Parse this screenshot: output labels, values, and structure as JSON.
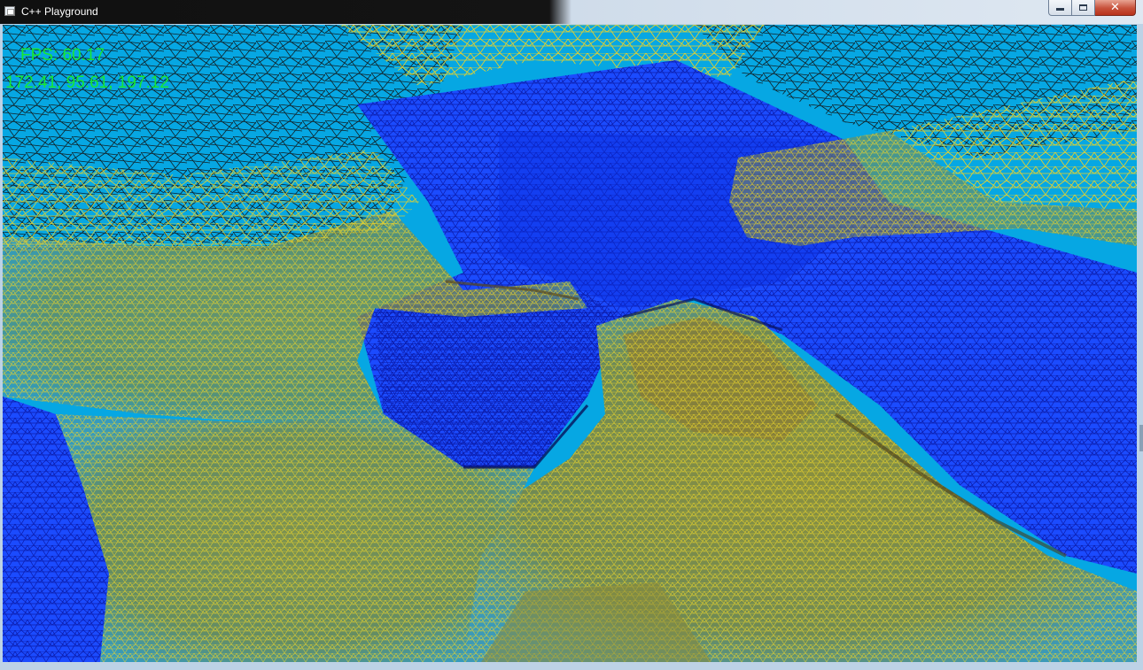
{
  "window": {
    "title": "C++ Playground",
    "icon": "console-window-icon",
    "buttons": {
      "minimize": "minimize-icon",
      "maximize": "maximize-icon",
      "close": "close-icon"
    },
    "close_glyph": "✕"
  },
  "hud": {
    "fps": "FPS: 60.17",
    "coords": "172.41, 95.61, 197.12"
  },
  "colors": {
    "sky": "#06a7e3",
    "water": "#1b4bff",
    "water_wire": "#0a1aa8",
    "land": "#7f8640",
    "land_wire": "#e8d22a",
    "hill_wire": "#111111",
    "hud_text": "#17e632"
  }
}
